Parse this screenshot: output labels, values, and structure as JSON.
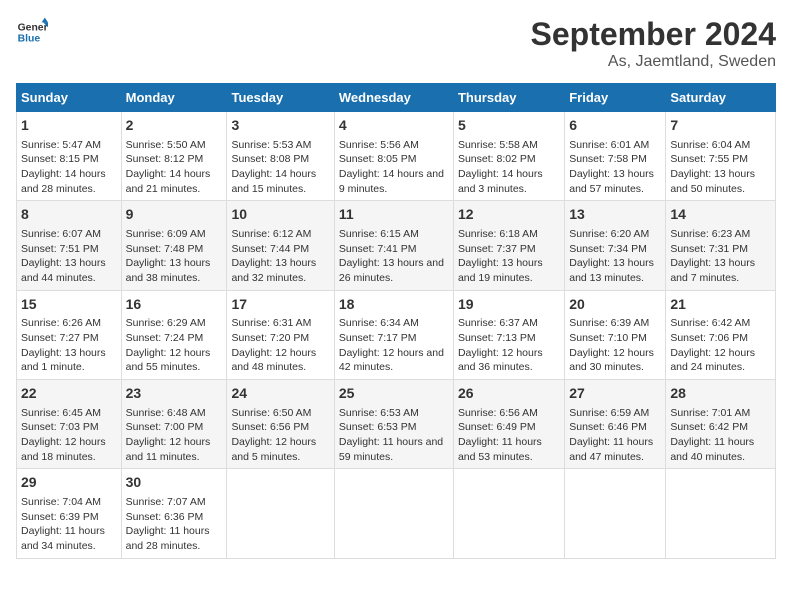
{
  "header": {
    "logo_line1": "General",
    "logo_line2": "Blue",
    "month": "September 2024",
    "location": "As, Jaemtland, Sweden"
  },
  "weekdays": [
    "Sunday",
    "Monday",
    "Tuesday",
    "Wednesday",
    "Thursday",
    "Friday",
    "Saturday"
  ],
  "weeks": [
    [
      {
        "day": "1",
        "sunrise": "Sunrise: 5:47 AM",
        "sunset": "Sunset: 8:15 PM",
        "daylight": "Daylight: 14 hours and 28 minutes."
      },
      {
        "day": "2",
        "sunrise": "Sunrise: 5:50 AM",
        "sunset": "Sunset: 8:12 PM",
        "daylight": "Daylight: 14 hours and 21 minutes."
      },
      {
        "day": "3",
        "sunrise": "Sunrise: 5:53 AM",
        "sunset": "Sunset: 8:08 PM",
        "daylight": "Daylight: 14 hours and 15 minutes."
      },
      {
        "day": "4",
        "sunrise": "Sunrise: 5:56 AM",
        "sunset": "Sunset: 8:05 PM",
        "daylight": "Daylight: 14 hours and 9 minutes."
      },
      {
        "day": "5",
        "sunrise": "Sunrise: 5:58 AM",
        "sunset": "Sunset: 8:02 PM",
        "daylight": "Daylight: 14 hours and 3 minutes."
      },
      {
        "day": "6",
        "sunrise": "Sunrise: 6:01 AM",
        "sunset": "Sunset: 7:58 PM",
        "daylight": "Daylight: 13 hours and 57 minutes."
      },
      {
        "day": "7",
        "sunrise": "Sunrise: 6:04 AM",
        "sunset": "Sunset: 7:55 PM",
        "daylight": "Daylight: 13 hours and 50 minutes."
      }
    ],
    [
      {
        "day": "8",
        "sunrise": "Sunrise: 6:07 AM",
        "sunset": "Sunset: 7:51 PM",
        "daylight": "Daylight: 13 hours and 44 minutes."
      },
      {
        "day": "9",
        "sunrise": "Sunrise: 6:09 AM",
        "sunset": "Sunset: 7:48 PM",
        "daylight": "Daylight: 13 hours and 38 minutes."
      },
      {
        "day": "10",
        "sunrise": "Sunrise: 6:12 AM",
        "sunset": "Sunset: 7:44 PM",
        "daylight": "Daylight: 13 hours and 32 minutes."
      },
      {
        "day": "11",
        "sunrise": "Sunrise: 6:15 AM",
        "sunset": "Sunset: 7:41 PM",
        "daylight": "Daylight: 13 hours and 26 minutes."
      },
      {
        "day": "12",
        "sunrise": "Sunrise: 6:18 AM",
        "sunset": "Sunset: 7:37 PM",
        "daylight": "Daylight: 13 hours and 19 minutes."
      },
      {
        "day": "13",
        "sunrise": "Sunrise: 6:20 AM",
        "sunset": "Sunset: 7:34 PM",
        "daylight": "Daylight: 13 hours and 13 minutes."
      },
      {
        "day": "14",
        "sunrise": "Sunrise: 6:23 AM",
        "sunset": "Sunset: 7:31 PM",
        "daylight": "Daylight: 13 hours and 7 minutes."
      }
    ],
    [
      {
        "day": "15",
        "sunrise": "Sunrise: 6:26 AM",
        "sunset": "Sunset: 7:27 PM",
        "daylight": "Daylight: 13 hours and 1 minute."
      },
      {
        "day": "16",
        "sunrise": "Sunrise: 6:29 AM",
        "sunset": "Sunset: 7:24 PM",
        "daylight": "Daylight: 12 hours and 55 minutes."
      },
      {
        "day": "17",
        "sunrise": "Sunrise: 6:31 AM",
        "sunset": "Sunset: 7:20 PM",
        "daylight": "Daylight: 12 hours and 48 minutes."
      },
      {
        "day": "18",
        "sunrise": "Sunrise: 6:34 AM",
        "sunset": "Sunset: 7:17 PM",
        "daylight": "Daylight: 12 hours and 42 minutes."
      },
      {
        "day": "19",
        "sunrise": "Sunrise: 6:37 AM",
        "sunset": "Sunset: 7:13 PM",
        "daylight": "Daylight: 12 hours and 36 minutes."
      },
      {
        "day": "20",
        "sunrise": "Sunrise: 6:39 AM",
        "sunset": "Sunset: 7:10 PM",
        "daylight": "Daylight: 12 hours and 30 minutes."
      },
      {
        "day": "21",
        "sunrise": "Sunrise: 6:42 AM",
        "sunset": "Sunset: 7:06 PM",
        "daylight": "Daylight: 12 hours and 24 minutes."
      }
    ],
    [
      {
        "day": "22",
        "sunrise": "Sunrise: 6:45 AM",
        "sunset": "Sunset: 7:03 PM",
        "daylight": "Daylight: 12 hours and 18 minutes."
      },
      {
        "day": "23",
        "sunrise": "Sunrise: 6:48 AM",
        "sunset": "Sunset: 7:00 PM",
        "daylight": "Daylight: 12 hours and 11 minutes."
      },
      {
        "day": "24",
        "sunrise": "Sunrise: 6:50 AM",
        "sunset": "Sunset: 6:56 PM",
        "daylight": "Daylight: 12 hours and 5 minutes."
      },
      {
        "day": "25",
        "sunrise": "Sunrise: 6:53 AM",
        "sunset": "Sunset: 6:53 PM",
        "daylight": "Daylight: 11 hours and 59 minutes."
      },
      {
        "day": "26",
        "sunrise": "Sunrise: 6:56 AM",
        "sunset": "Sunset: 6:49 PM",
        "daylight": "Daylight: 11 hours and 53 minutes."
      },
      {
        "day": "27",
        "sunrise": "Sunrise: 6:59 AM",
        "sunset": "Sunset: 6:46 PM",
        "daylight": "Daylight: 11 hours and 47 minutes."
      },
      {
        "day": "28",
        "sunrise": "Sunrise: 7:01 AM",
        "sunset": "Sunset: 6:42 PM",
        "daylight": "Daylight: 11 hours and 40 minutes."
      }
    ],
    [
      {
        "day": "29",
        "sunrise": "Sunrise: 7:04 AM",
        "sunset": "Sunset: 6:39 PM",
        "daylight": "Daylight: 11 hours and 34 minutes."
      },
      {
        "day": "30",
        "sunrise": "Sunrise: 7:07 AM",
        "sunset": "Sunset: 6:36 PM",
        "daylight": "Daylight: 11 hours and 28 minutes."
      },
      null,
      null,
      null,
      null,
      null
    ]
  ]
}
